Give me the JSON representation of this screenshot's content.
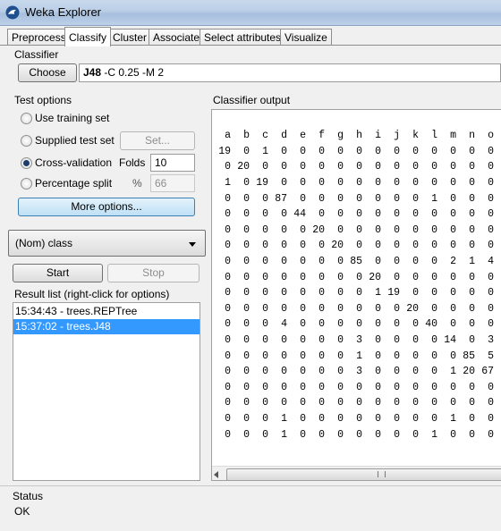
{
  "window": {
    "title": "Weka Explorer"
  },
  "tabs": [
    "Preprocess",
    "Classify",
    "Cluster",
    "Associate",
    "Select attributes",
    "Visualize"
  ],
  "classifier": {
    "group_label": "Classifier",
    "choose_label": "Choose",
    "name": "J48",
    "options": " -C 0.25 -M 2"
  },
  "test_options": {
    "group_label": "Test options",
    "use_training": "Use training set",
    "supplied_test": "Supplied test set",
    "set_button": "Set...",
    "cross_validation": "Cross-validation",
    "folds_label": "Folds",
    "folds_value": "10",
    "percentage_split": "Percentage split",
    "percent_symbol": "%",
    "percent_value": "66",
    "selected": "cross_validation",
    "more_options": "More options..."
  },
  "class_select": {
    "value": "(Nom) class"
  },
  "actions": {
    "start": "Start",
    "stop": "Stop"
  },
  "result_list": {
    "label": "Result list (right-click for options)",
    "items": [
      {
        "text": "15:34:43 - trees.REPTree",
        "selected": false
      },
      {
        "text": "15:37:02 - trees.J48",
        "selected": true
      }
    ]
  },
  "output": {
    "label": "Classifier output",
    "columns": [
      "a",
      "b",
      "c",
      "d",
      "e",
      "f",
      "g",
      "h",
      "i",
      "j",
      "k",
      "l",
      "m",
      "n",
      "o"
    ],
    "rows": [
      [
        "19",
        "0",
        "1",
        "0",
        "0",
        "0",
        "0",
        "0",
        "0",
        "0",
        "0",
        "0",
        "0",
        "0",
        "0"
      ],
      [
        "0",
        "20",
        "0",
        "0",
        "0",
        "0",
        "0",
        "0",
        "0",
        "0",
        "0",
        "0",
        "0",
        "0",
        "0"
      ],
      [
        "1",
        "0",
        "19",
        "0",
        "0",
        "0",
        "0",
        "0",
        "0",
        "0",
        "0",
        "0",
        "0",
        "0",
        "0"
      ],
      [
        "0",
        "0",
        "0",
        "87",
        "0",
        "0",
        "0",
        "0",
        "0",
        "0",
        "0",
        "1",
        "0",
        "0",
        "0"
      ],
      [
        "0",
        "0",
        "0",
        "0",
        "44",
        "0",
        "0",
        "0",
        "0",
        "0",
        "0",
        "0",
        "0",
        "0",
        "0"
      ],
      [
        "0",
        "0",
        "0",
        "0",
        "0",
        "20",
        "0",
        "0",
        "0",
        "0",
        "0",
        "0",
        "0",
        "0",
        "0"
      ],
      [
        "0",
        "0",
        "0",
        "0",
        "0",
        "0",
        "20",
        "0",
        "0",
        "0",
        "0",
        "0",
        "0",
        "0",
        "0"
      ],
      [
        "0",
        "0",
        "0",
        "0",
        "0",
        "0",
        "0",
        "85",
        "0",
        "0",
        "0",
        "0",
        "2",
        "1",
        "4"
      ],
      [
        "0",
        "0",
        "0",
        "0",
        "0",
        "0",
        "0",
        "0",
        "20",
        "0",
        "0",
        "0",
        "0",
        "0",
        "0"
      ],
      [
        "0",
        "0",
        "0",
        "0",
        "0",
        "0",
        "0",
        "0",
        "1",
        "19",
        "0",
        "0",
        "0",
        "0",
        "0"
      ],
      [
        "0",
        "0",
        "0",
        "0",
        "0",
        "0",
        "0",
        "0",
        "0",
        "0",
        "20",
        "0",
        "0",
        "0",
        "0"
      ],
      [
        "0",
        "0",
        "0",
        "4",
        "0",
        "0",
        "0",
        "0",
        "0",
        "0",
        "0",
        "40",
        "0",
        "0",
        "0"
      ],
      [
        "0",
        "0",
        "0",
        "0",
        "0",
        "0",
        "0",
        "3",
        "0",
        "0",
        "0",
        "0",
        "14",
        "0",
        "3"
      ],
      [
        "0",
        "0",
        "0",
        "0",
        "0",
        "0",
        "0",
        "1",
        "0",
        "0",
        "0",
        "0",
        "0",
        "85",
        "5"
      ],
      [
        "0",
        "0",
        "0",
        "0",
        "0",
        "0",
        "0",
        "3",
        "0",
        "0",
        "0",
        "0",
        "1",
        "20",
        "67"
      ],
      [
        "0",
        "0",
        "0",
        "0",
        "0",
        "0",
        "0",
        "0",
        "0",
        "0",
        "0",
        "0",
        "0",
        "0",
        "0"
      ],
      [
        "0",
        "0",
        "0",
        "0",
        "0",
        "0",
        "0",
        "0",
        "0",
        "0",
        "0",
        "0",
        "0",
        "0",
        "0"
      ],
      [
        "0",
        "0",
        "0",
        "1",
        "0",
        "0",
        "0",
        "0",
        "0",
        "0",
        "0",
        "0",
        "1",
        "0",
        "0"
      ],
      [
        "0",
        "0",
        "0",
        "1",
        "0",
        "0",
        "0",
        "0",
        "0",
        "0",
        "0",
        "1",
        "0",
        "0",
        "0"
      ]
    ]
  },
  "status": {
    "label": "Status",
    "text": "OK"
  },
  "colors": {
    "selection": "#3399ff",
    "more_options_bg": "#cde6f7"
  }
}
